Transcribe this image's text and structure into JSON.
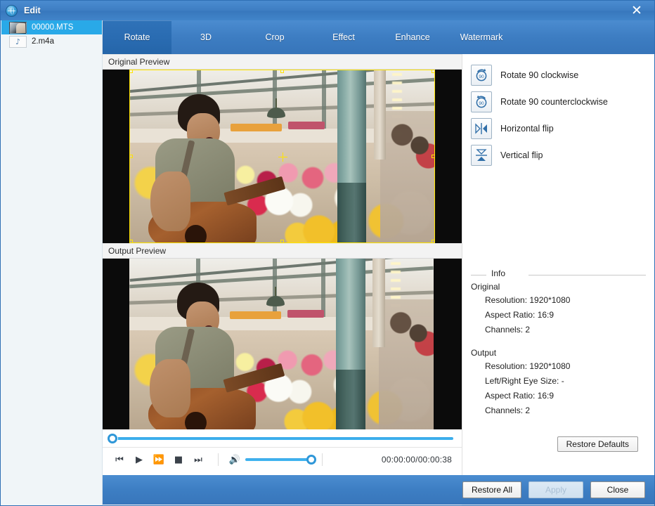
{
  "window": {
    "title": "Edit",
    "app_icon": "globe-icon",
    "close_label": "✕"
  },
  "sidebar": {
    "files": [
      {
        "name": "00000.MTS",
        "icon": "video-thumbnail",
        "selected": true
      },
      {
        "name": "2.m4a",
        "icon": "music-note-icon",
        "selected": false
      }
    ]
  },
  "tabs": [
    {
      "label": "Rotate",
      "active": true
    },
    {
      "label": "3D",
      "active": false
    },
    {
      "label": "Crop",
      "active": false
    },
    {
      "label": "Effect",
      "active": false
    },
    {
      "label": "Enhance",
      "active": false
    },
    {
      "label": "Watermark",
      "active": false
    }
  ],
  "preview": {
    "original_label": "Original Preview",
    "output_label": "Output Preview"
  },
  "transport": {
    "previous_icon": "skip-previous-icon",
    "play_icon": "play-icon",
    "forward_icon": "fast-forward-icon",
    "stop_icon": "stop-icon",
    "next_icon": "skip-next-icon",
    "volume_icon": "speaker-icon",
    "seek_position_percent": 0,
    "volume_percent": 100,
    "timecode": "00:00:00/00:00:38"
  },
  "rotate_actions": [
    {
      "label": "Rotate 90 clockwise",
      "icon": "rotate-cw-90-icon"
    },
    {
      "label": "Rotate 90 counterclockwise",
      "icon": "rotate-ccw-90-icon"
    },
    {
      "label": "Horizontal flip",
      "icon": "horizontal-flip-icon"
    },
    {
      "label": "Vertical flip",
      "icon": "vertical-flip-icon"
    }
  ],
  "info": {
    "legend": "Info",
    "original_heading": "Original",
    "original_lines": [
      "Resolution: 1920*1080",
      "Aspect Ratio: 16:9",
      "Channels: 2"
    ],
    "output_heading": "Output",
    "output_lines": [
      "Resolution: 1920*1080",
      "Left/Right Eye Size: -",
      "Aspect Ratio: 16:9",
      "Channels: 2"
    ],
    "restore_defaults_label": "Restore Defaults"
  },
  "footer": {
    "restore_all_label": "Restore All",
    "apply_label": "Apply",
    "apply_enabled": false,
    "close_label": "Close"
  },
  "colors": {
    "title_blue": "#3f7fc4",
    "tab_active": "#2a6cb2",
    "selection_blue": "#29a9e8",
    "slider_blue": "#38a8e8",
    "crop_yellow": "#ffe400",
    "sidebar_bg": "#f0f5f8"
  }
}
